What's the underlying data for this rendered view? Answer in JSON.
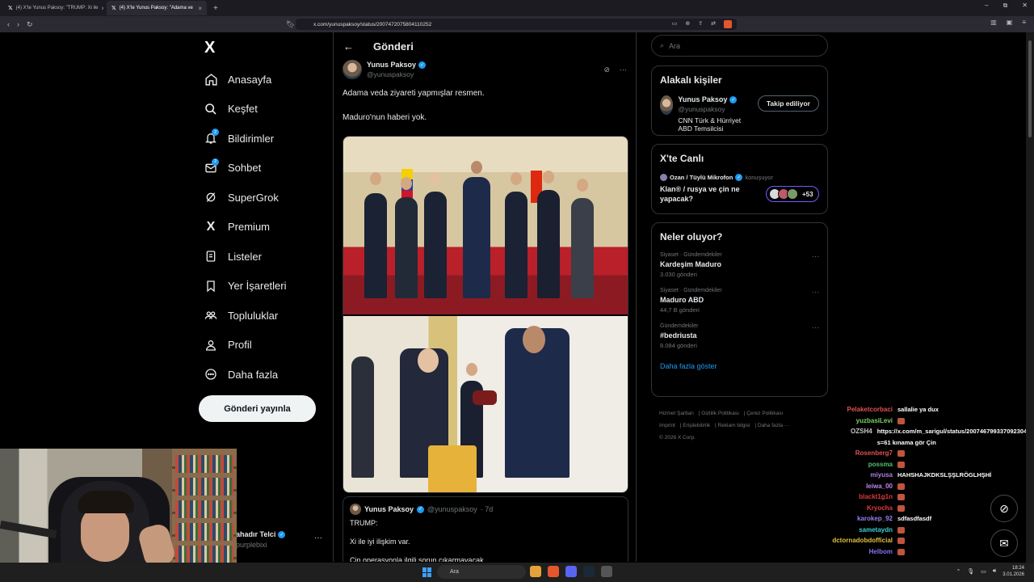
{
  "browser": {
    "tabs": [
      {
        "label": "(4) X'te Yunus Paksoy: \"TRUMP: Xi ile",
        "active": false
      },
      {
        "label": "(4) X'te Yunus Paksoy: \"Adama ve",
        "active": true
      }
    ],
    "url": "x.com/yunuspaksoy/status/2007472075804110252"
  },
  "sidebar": {
    "logo": "X",
    "items": [
      {
        "label": "Anasayfa",
        "icon": "home-icon"
      },
      {
        "label": "Keşfet",
        "icon": "search-icon"
      },
      {
        "label": "Bildirimler",
        "icon": "bell-icon",
        "badge": "2"
      },
      {
        "label": "Sohbet",
        "icon": "mail-icon",
        "badge": "2"
      },
      {
        "label": "SuperGrok",
        "icon": "grok-icon"
      },
      {
        "label": "Premium",
        "icon": "x-premium-icon"
      },
      {
        "label": "Listeler",
        "icon": "list-icon"
      },
      {
        "label": "Yer İşaretleri",
        "icon": "bookmark-icon"
      },
      {
        "label": "Topluluklar",
        "icon": "communities-icon"
      },
      {
        "label": "Profil",
        "icon": "profile-icon"
      },
      {
        "label": "Daha fazla",
        "icon": "more-circle-icon"
      }
    ],
    "post_button": "Gönderi yayınla",
    "account_name": "ahadır Telci",
    "account_handle": "purplebixi",
    "account_more": "···"
  },
  "main": {
    "back": "←",
    "title": "Gönderi",
    "author_name": "Yunus Paksoy",
    "author_handle": "@yunuspaksoy",
    "text_lines": [
      "Adama veda ziyareti yapmışlar resmen.",
      "Maduro'nun haberi yok."
    ],
    "quote": {
      "name": "Yunus Paksoy",
      "handle": "@yunuspaksoy",
      "age": "· 7d",
      "lines": [
        "TRUMP:",
        "Xi ile iyi ilişkim var.",
        "Çin operasyonla ilgili sorun çıkarmayacak...."
      ]
    }
  },
  "right": {
    "search_placeholder": "Ara",
    "related": {
      "title": "Alakalı kişiler",
      "name": "Yunus Paksoy",
      "handle": "@yunuspaksoy",
      "bio": "CNN Türk & Hürriyet ABD Temsilcisi",
      "follow_label": "Takip ediliyor"
    },
    "live": {
      "title": "X'te Canlı",
      "host": "Ozan / Tüylü Mikrofon",
      "status": "konuşuyor",
      "space_title": "Klan® / rusya ve çin ne yapacak?",
      "count": "+53"
    },
    "trends": {
      "title": "Neler oluyor?",
      "items": [
        {
          "category": "Siyaset · Gündemdekiler",
          "name": "Kardeşim Maduro",
          "posts": "3.030 gönderi"
        },
        {
          "category": "Siyaset · Gündemdekiler",
          "name": "Maduro ABD",
          "posts": "44,7 B gönderi"
        },
        {
          "category": "Gündemdekiler",
          "name": "#bedriusta",
          "posts": "8.084 gönderi"
        }
      ],
      "more": "Daha fazla göster"
    },
    "footer": [
      "Hizmet Şartları",
      "Gizlilik Politikası",
      "Çerez Politikası",
      "Imprint",
      "Erişilebilirlik",
      "Reklam bilgisi",
      "Daha fazla ···",
      "© 2026 X Corp."
    ]
  },
  "chat": [
    {
      "user": "Pelaketcorbaci",
      "color": "#e05252",
      "msg": "sallalie ya dux"
    },
    {
      "user": "yuzbasiLevi",
      "color": "#7bd36a",
      "msg": ""
    },
    {
      "user": "OZSH4",
      "color": "#c9c9c9",
      "msg": "https://x.com/m_sarigul/status/2007467993370923048?s=61 kınama gör Çin"
    },
    {
      "user": "Rosenberg7",
      "color": "#e05252",
      "msg": ""
    },
    {
      "user": "possma",
      "color": "#4fc46c",
      "msg": ""
    },
    {
      "user": "miyusa",
      "color": "#b07fe0",
      "msg": "HAHSHAJKDKSLŞŞLRÖGLHŞHİ"
    },
    {
      "user": "leiwa_00",
      "color": "#c087f0",
      "msg": ""
    },
    {
      "user": "blackt1g1n",
      "color": "#e03a3a",
      "msg": ""
    },
    {
      "user": "Kryocha",
      "color": "#e03a3a",
      "msg": ""
    },
    {
      "user": "karokep_92",
      "color": "#9a7ff0",
      "msg": "sdfasdfasdf"
    },
    {
      "user": "sametaydn",
      "color": "#3ecfcf",
      "msg": ""
    },
    {
      "user": "dctornadobdofficial",
      "color": "#e0c040",
      "msg": ""
    },
    {
      "user": "Helbom",
      "color": "#8a6ff0",
      "msg": ""
    }
  ],
  "taskbar": {
    "search": "Ara",
    "time": "18:24",
    "date": "3.01.2026"
  }
}
